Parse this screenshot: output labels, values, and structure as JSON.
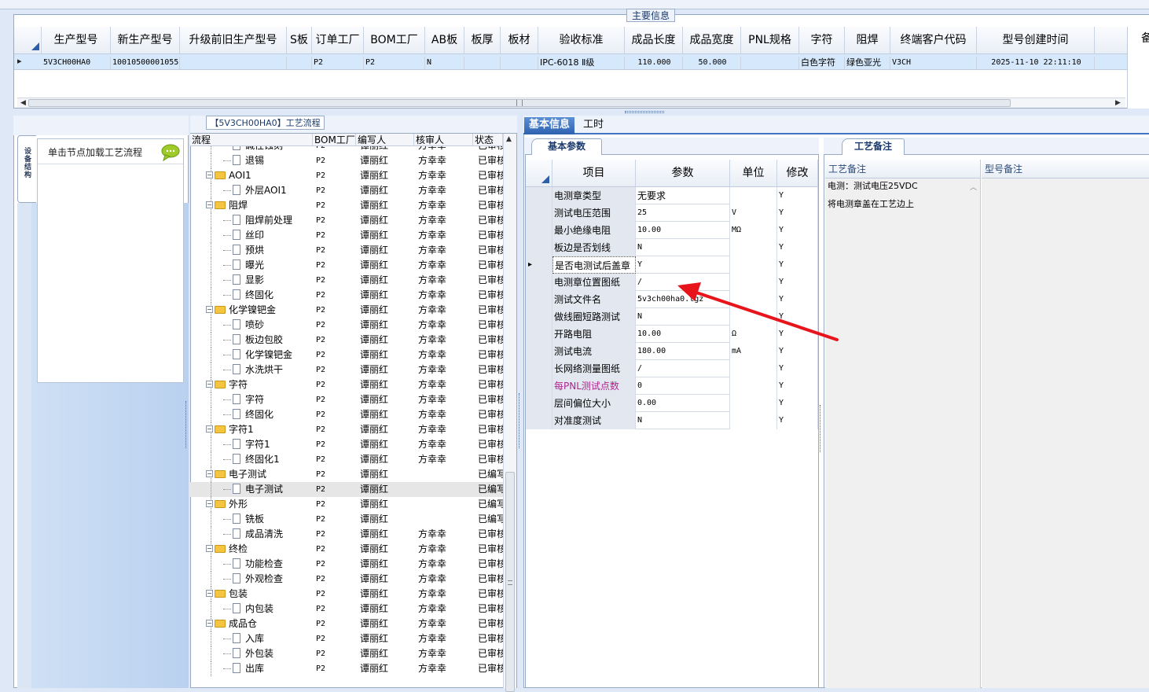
{
  "main_panel": {
    "title": "主要信息",
    "columns": [
      "生产型号",
      "新生产型号",
      "升级前旧生产型号",
      "S板",
      "订单工厂",
      "BOM工厂",
      "AB板",
      "板厚",
      "板材",
      "验收标准",
      "成品长度",
      "成品宽度",
      "PNL规格",
      "字符",
      "阻焊",
      "终端客户代码",
      "型号创建时间"
    ],
    "row": {
      "marker": "▸",
      "values": [
        "5V3CH00HA0",
        "10010500001055",
        "",
        "",
        "P2",
        "P2",
        "N",
        "",
        "",
        "IPC-6018 Ⅱ级",
        "110.000",
        "50.000",
        "",
        "白色字符",
        "绿色亚光",
        "V3CH",
        "2025-11-10 22:11:10"
      ]
    }
  },
  "left_side_tab": "设备结构",
  "node_panel": {
    "hint": "单击节点加载工艺流程",
    "chat_icon": "speech-bubble-icon"
  },
  "flow_panel": {
    "title": "【5V3CH00HA0】工艺流程",
    "columns": [
      "流程",
      "BOM工厂",
      "编写人",
      "核审人",
      "状态"
    ],
    "rows": [
      {
        "level": 2,
        "type": "doc",
        "name": "碱性蚀刻",
        "bom": "P2",
        "writer": "谭丽红",
        "checker": "方幸幸",
        "status": "已审核"
      },
      {
        "level": 2,
        "type": "doc",
        "name": "退锡",
        "bom": "P2",
        "writer": "谭丽红",
        "checker": "方幸幸",
        "status": "已审核"
      },
      {
        "level": 1,
        "type": "folder",
        "name": "AOI1",
        "bom": "P2",
        "writer": "谭丽红",
        "checker": "方幸幸",
        "status": "已审核"
      },
      {
        "level": 2,
        "type": "doc",
        "name": "外层AOI1",
        "bom": "P2",
        "writer": "谭丽红",
        "checker": "方幸幸",
        "status": "已审核"
      },
      {
        "level": 1,
        "type": "folder",
        "name": "阻焊",
        "bom": "P2",
        "writer": "谭丽红",
        "checker": "方幸幸",
        "status": "已审核"
      },
      {
        "level": 2,
        "type": "doc",
        "name": "阻焊前处理",
        "bom": "P2",
        "writer": "谭丽红",
        "checker": "方幸幸",
        "status": "已审核"
      },
      {
        "level": 2,
        "type": "doc",
        "name": "丝印",
        "bom": "P2",
        "writer": "谭丽红",
        "checker": "方幸幸",
        "status": "已审核"
      },
      {
        "level": 2,
        "type": "doc",
        "name": "预烘",
        "bom": "P2",
        "writer": "谭丽红",
        "checker": "方幸幸",
        "status": "已审核"
      },
      {
        "level": 2,
        "type": "doc",
        "name": "曝光",
        "bom": "P2",
        "writer": "谭丽红",
        "checker": "方幸幸",
        "status": "已审核"
      },
      {
        "level": 2,
        "type": "doc",
        "name": "显影",
        "bom": "P2",
        "writer": "谭丽红",
        "checker": "方幸幸",
        "status": "已审核"
      },
      {
        "level": 2,
        "type": "doc",
        "name": "终固化",
        "bom": "P2",
        "writer": "谭丽红",
        "checker": "方幸幸",
        "status": "已审核"
      },
      {
        "level": 1,
        "type": "folder",
        "name": "化学镍钯金",
        "bom": "P2",
        "writer": "谭丽红",
        "checker": "方幸幸",
        "status": "已审核"
      },
      {
        "level": 2,
        "type": "doc",
        "name": "喷砂",
        "bom": "P2",
        "writer": "谭丽红",
        "checker": "方幸幸",
        "status": "已审核"
      },
      {
        "level": 2,
        "type": "doc",
        "name": "板边包胶",
        "bom": "P2",
        "writer": "谭丽红",
        "checker": "方幸幸",
        "status": "已审核"
      },
      {
        "level": 2,
        "type": "doc",
        "name": "化学镍钯金",
        "bom": "P2",
        "writer": "谭丽红",
        "checker": "方幸幸",
        "status": "已审核"
      },
      {
        "level": 2,
        "type": "doc",
        "name": "水洗烘干",
        "bom": "P2",
        "writer": "谭丽红",
        "checker": "方幸幸",
        "status": "已审核"
      },
      {
        "level": 1,
        "type": "folder",
        "name": "字符",
        "bom": "P2",
        "writer": "谭丽红",
        "checker": "方幸幸",
        "status": "已审核"
      },
      {
        "level": 2,
        "type": "doc",
        "name": "字符",
        "bom": "P2",
        "writer": "谭丽红",
        "checker": "方幸幸",
        "status": "已审核"
      },
      {
        "level": 2,
        "type": "doc",
        "name": "终固化",
        "bom": "P2",
        "writer": "谭丽红",
        "checker": "方幸幸",
        "status": "已审核"
      },
      {
        "level": 1,
        "type": "folder",
        "name": "字符1",
        "bom": "P2",
        "writer": "谭丽红",
        "checker": "方幸幸",
        "status": "已审核"
      },
      {
        "level": 2,
        "type": "doc",
        "name": "字符1",
        "bom": "P2",
        "writer": "谭丽红",
        "checker": "方幸幸",
        "status": "已审核"
      },
      {
        "level": 2,
        "type": "doc",
        "name": "终固化1",
        "bom": "P2",
        "writer": "谭丽红",
        "checker": "方幸幸",
        "status": "已审核"
      },
      {
        "level": 1,
        "type": "folder",
        "name": "电子测试",
        "bom": "P2",
        "writer": "谭丽红",
        "checker": "",
        "status": "已编写"
      },
      {
        "level": 2,
        "type": "doc",
        "name": "电子测试",
        "bom": "P2",
        "writer": "谭丽红",
        "checker": "",
        "status": "已编写",
        "selected": true
      },
      {
        "level": 1,
        "type": "folder",
        "name": "外形",
        "bom": "P2",
        "writer": "谭丽红",
        "checker": "",
        "status": "已编写"
      },
      {
        "level": 2,
        "type": "doc",
        "name": "铣板",
        "bom": "P2",
        "writer": "谭丽红",
        "checker": "",
        "status": "已编写"
      },
      {
        "level": 2,
        "type": "doc",
        "name": "成品清洗",
        "bom": "P2",
        "writer": "谭丽红",
        "checker": "方幸幸",
        "status": "已审核"
      },
      {
        "level": 1,
        "type": "folder",
        "name": "终检",
        "bom": "P2",
        "writer": "谭丽红",
        "checker": "方幸幸",
        "status": "已审核"
      },
      {
        "level": 2,
        "type": "doc",
        "name": "功能检查",
        "bom": "P2",
        "writer": "谭丽红",
        "checker": "方幸幸",
        "status": "已审核"
      },
      {
        "level": 2,
        "type": "doc",
        "name": "外观检查",
        "bom": "P2",
        "writer": "谭丽红",
        "checker": "方幸幸",
        "status": "已审核"
      },
      {
        "level": 1,
        "type": "folder",
        "name": "包装",
        "bom": "P2",
        "writer": "谭丽红",
        "checker": "方幸幸",
        "status": "已审核"
      },
      {
        "level": 2,
        "type": "doc",
        "name": "内包装",
        "bom": "P2",
        "writer": "谭丽红",
        "checker": "方幸幸",
        "status": "已审核"
      },
      {
        "level": 1,
        "type": "folder",
        "name": "成品仓",
        "bom": "P2",
        "writer": "谭丽红",
        "checker": "方幸幸",
        "status": "已审核"
      },
      {
        "level": 2,
        "type": "doc",
        "name": "入库",
        "bom": "P2",
        "writer": "谭丽红",
        "checker": "方幸幸",
        "status": "已审核"
      },
      {
        "level": 2,
        "type": "doc",
        "name": "外包装",
        "bom": "P2",
        "writer": "谭丽红",
        "checker": "方幸幸",
        "status": "已审核"
      },
      {
        "level": 2,
        "type": "doc",
        "name": "出库",
        "bom": "P2",
        "writer": "谭丽红",
        "checker": "方幸幸",
        "status": "已审核"
      }
    ]
  },
  "info_tabs": [
    "基本信息",
    "工时"
  ],
  "params_panel": {
    "tab": "基本参数",
    "columns": [
      "项目",
      "参数",
      "单位",
      "修改"
    ],
    "rows": [
      {
        "item": "电测章类型",
        "param": "无要求",
        "unit": "",
        "mod": "Y"
      },
      {
        "item": "测试电压范围",
        "param": "25",
        "unit": "V",
        "mod": "Y"
      },
      {
        "item": "最小绝缘电阻",
        "param": "10.00",
        "unit": "MΩ",
        "mod": "Y"
      },
      {
        "item": "板边是否划线",
        "param": "N",
        "unit": "",
        "mod": "Y"
      },
      {
        "item": "是否电测试后盖章",
        "param": "Y",
        "unit": "",
        "mod": "Y",
        "current": true
      },
      {
        "item": "电测章位置图纸",
        "param": "/",
        "unit": "",
        "mod": "Y"
      },
      {
        "item": "测试文件名",
        "param": "5v3ch00ha0.tgz",
        "unit": "",
        "mod": "Y"
      },
      {
        "item": "做线圈短路测试",
        "param": "N",
        "unit": "",
        "mod": "Y"
      },
      {
        "item": "开路电阻",
        "param": "10.00",
        "unit": "Ω",
        "mod": "Y"
      },
      {
        "item": "测试电流",
        "param": "180.00",
        "unit": "mA",
        "mod": "Y"
      },
      {
        "item": "长网络测量图纸",
        "param": "/",
        "unit": "",
        "mod": "Y"
      },
      {
        "item": "每PNL测试点数",
        "param": "0",
        "unit": "",
        "mod": "Y",
        "highlight": true
      },
      {
        "item": "层间偏位大小",
        "param": "0.00",
        "unit": "",
        "mod": "Y"
      },
      {
        "item": "对准度测试",
        "param": "N",
        "unit": "",
        "mod": "Y"
      }
    ],
    "highlight_color": "#b0248f"
  },
  "remarks_panel": {
    "tab": "工艺备注",
    "col1": "工艺备注",
    "col2": "型号备注",
    "lines": [
      "电测：测试电压25VDC",
      "将电测章盖在工艺边上"
    ]
  },
  "arrow_color": "#e8141b",
  "right_edge_text": "备"
}
